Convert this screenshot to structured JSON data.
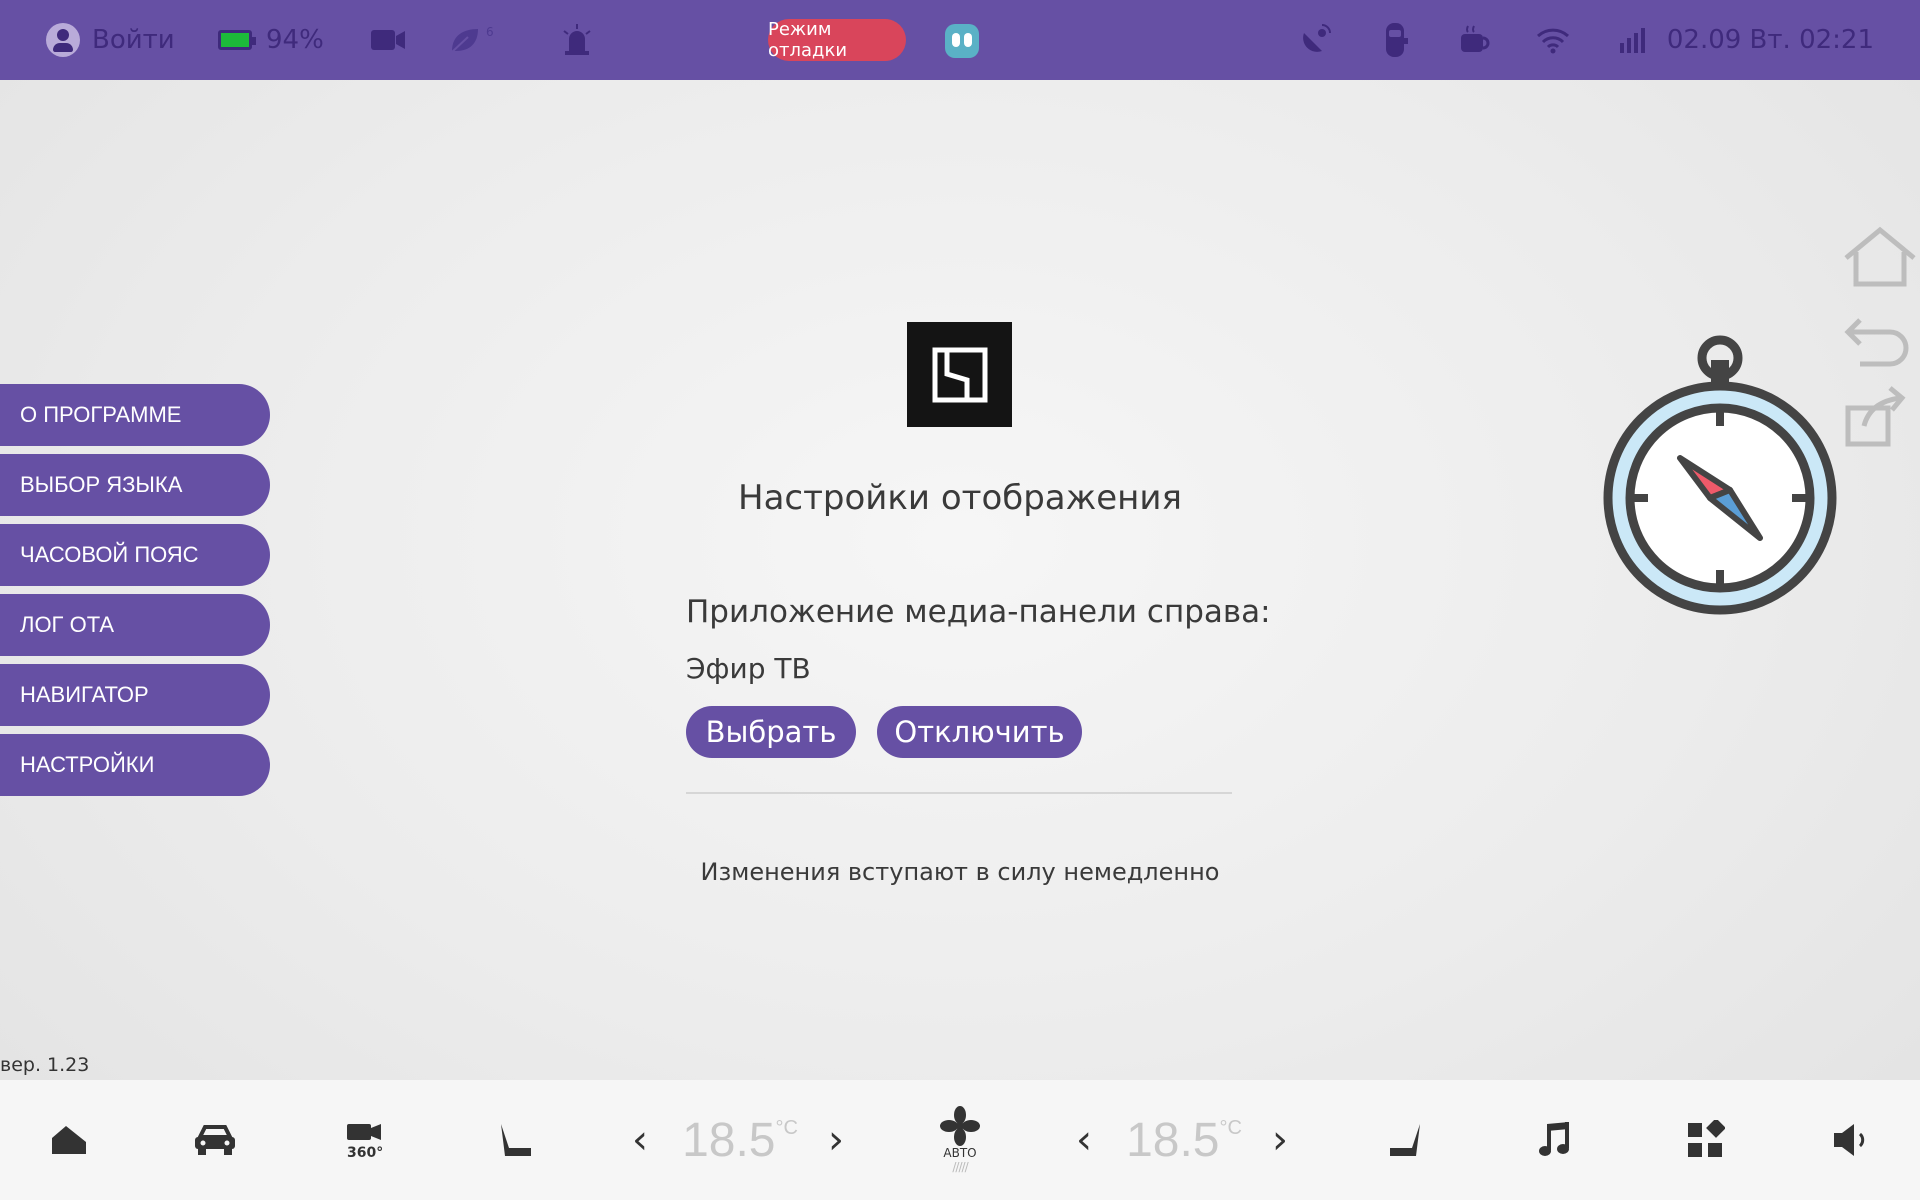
{
  "statusbar": {
    "login": "Войти",
    "battery": "94%",
    "eco_small": "6",
    "debug_mode": "Режим отладки",
    "datetime": "02.09 Вт. 02:21"
  },
  "sidebar": {
    "items": [
      {
        "label": "О ПРОГРАММЕ"
      },
      {
        "label": "ВЫБОР ЯЗЫКА"
      },
      {
        "label": "ЧАСОВОЙ ПОЯС"
      },
      {
        "label": "ЛОГ ОТА"
      },
      {
        "label": "НАВИГАТОР"
      },
      {
        "label": "НАСТРОЙКИ"
      }
    ]
  },
  "main": {
    "title": "Настройки отображения",
    "media_panel_label": "Приложение медиа-панели справа:",
    "media_panel_value": "Эфир ТВ",
    "select_label": "Выбрать",
    "disable_label": "Отключить",
    "note": "Изменения вступают в силу немедленно"
  },
  "version": "вер. 1.23",
  "climate": {
    "left_temp": "18.5",
    "right_temp": "18.5",
    "unit": "°C",
    "fan_mode": "АВТО"
  },
  "colors": {
    "accent": "#6650a4",
    "statusbar_icons": "#3f2a7c",
    "debug_pill": "#d9455b",
    "battery_fill": "#1db93a"
  }
}
